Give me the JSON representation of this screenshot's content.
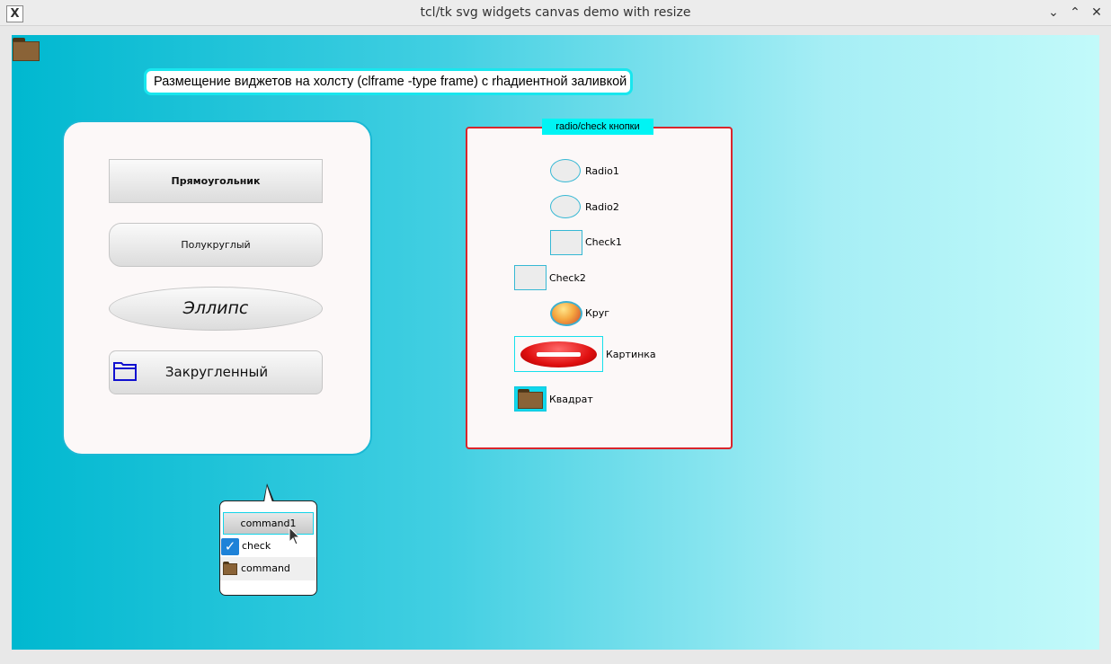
{
  "window": {
    "title": "tcl/tk svg widgets canvas demo with resize",
    "app_icon": "X",
    "controls": {
      "minimize": "⌄",
      "maximize": "⌃",
      "close": "✕"
    }
  },
  "canvas": {
    "gradient": [
      "#00b8d0",
      "#c2fafa"
    ],
    "header_label": "Размещение виджетов на холсту (clframe -type frame) с rhадиентной заливкой"
  },
  "left_panel": {
    "buttons": {
      "rect": "Прямоугольник",
      "semi": "Полукруглый",
      "ellipse": "Эллипс",
      "rounded": "Закругленный"
    }
  },
  "radio_panel": {
    "title": "radio/check кнопки",
    "radio1": "Radio1",
    "radio2": "Radio2",
    "check1": "Check1",
    "check2": "Check2",
    "circle": "Круг",
    "picture": "Картинка",
    "square": "Квадрат"
  },
  "popup_menu": {
    "command1": "command1",
    "check": "check",
    "check_checked": true,
    "command": "command"
  },
  "colors": {
    "accent_cyan": "#18e6ee",
    "panel_border_red": "#d9252c",
    "check_blue": "#1e82d8"
  }
}
